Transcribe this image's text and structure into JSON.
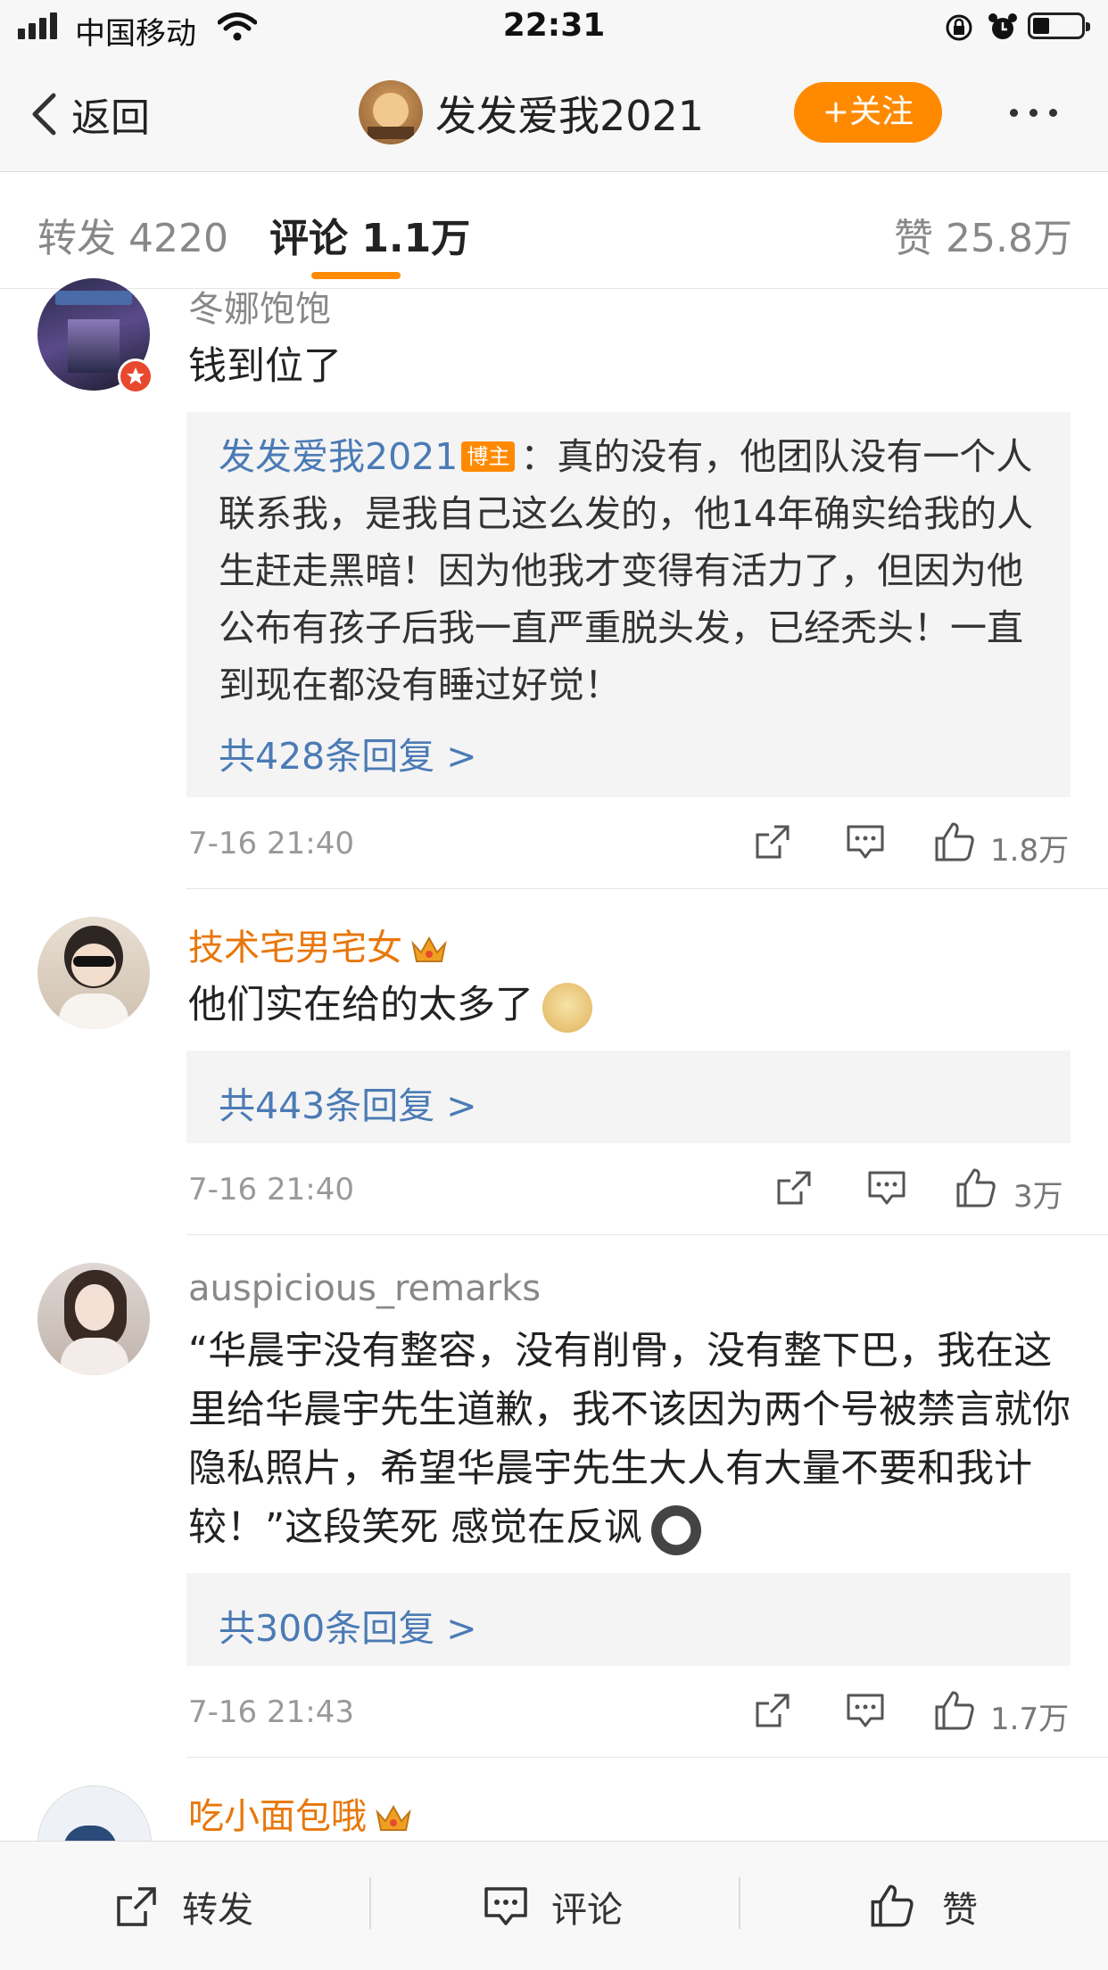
{
  "status": {
    "carrier": "中国移动",
    "time": "22:31"
  },
  "nav": {
    "back_label": "返回",
    "title": "发发爱我2021",
    "follow_label": "+关注"
  },
  "tabs": {
    "repost": "转发 4220",
    "comments": "评论 1.1万",
    "likes": "赞 25.8万"
  },
  "comments": [
    {
      "username": "冬娜饱饱",
      "text": "钱到位了",
      "reply": {
        "author": "发发爱我2021",
        "badge": "博主",
        "text": "：真的没有，他团队没有一个人联系我，是我自己这么发的，他14年确实给我的人生赶走黑暗！因为他我才变得有活力了，但因为他公布有孩子后我一直严重脱头发，已经秃头！一直到现在都没有睡过好觉！"
      },
      "reply_count": "共428条回复 >",
      "time": "7-16 21:40",
      "likes": "1.8万"
    },
    {
      "username": "技术宅男宅女",
      "text": "他们实在给的太多了",
      "reply_count": "共443条回复 >",
      "time": "7-16 21:40",
      "likes": "3万"
    },
    {
      "username": "auspicious_remarks",
      "text": "“华晨宇没有整容，没有削骨，没有整下巴，我在这里给华晨宇先生道歉，我不该因为两个号被禁言就你隐私照片，希望华晨宇先生大人有大量不要和我计较！”这段笑死 感觉在反讽",
      "reply_count": "共300条回复 >",
      "time": "7-16 21:43",
      "likes": "1.7万"
    },
    {
      "username": "吃小面包哦"
    }
  ],
  "bottom": {
    "repost": "转发",
    "comment": "评论",
    "like": "赞"
  },
  "colors": {
    "accent": "#ff8a00",
    "link": "#4b7bb5",
    "username_vip": "#e8770a"
  }
}
